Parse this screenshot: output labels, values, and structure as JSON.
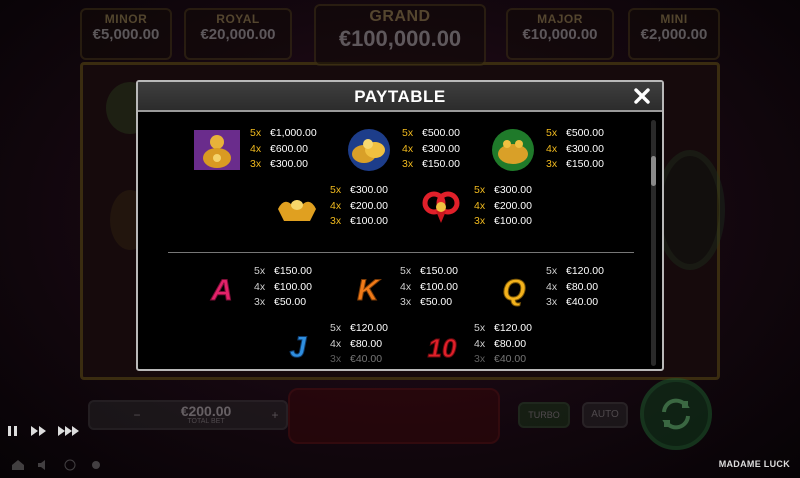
{
  "jackpots": {
    "minor": {
      "name": "MINOR",
      "value": "€5,000.00"
    },
    "royal": {
      "name": "ROYAL",
      "value": "€20,000.00"
    },
    "grand": {
      "name": "GRAND",
      "value": "€100,000.00"
    },
    "major": {
      "name": "MAJOR",
      "value": "€10,000.00"
    },
    "mini": {
      "name": "MINI",
      "value": "€2,000.00"
    }
  },
  "paytable": {
    "title": "PAYTABLE",
    "high_symbols": [
      {
        "icon": "buddha-purple-icon",
        "pays": [
          [
            "5x",
            "€1,000.00"
          ],
          [
            "4x",
            "€600.00"
          ],
          [
            "3x",
            "€300.00"
          ]
        ]
      },
      {
        "icon": "gold-coins-blue-icon",
        "pays": [
          [
            "5x",
            "€500.00"
          ],
          [
            "4x",
            "€300.00"
          ],
          [
            "3x",
            "€150.00"
          ]
        ]
      },
      {
        "icon": "money-toad-green-icon",
        "pays": [
          [
            "5x",
            "€500.00"
          ],
          [
            "4x",
            "€300.00"
          ],
          [
            "3x",
            "€150.00"
          ]
        ]
      },
      {
        "icon": "gold-ingot-icon",
        "pays": [
          [
            "5x",
            "€300.00"
          ],
          [
            "4x",
            "€200.00"
          ],
          [
            "3x",
            "€100.00"
          ]
        ]
      },
      {
        "icon": "red-knot-icon",
        "pays": [
          [
            "5x",
            "€300.00"
          ],
          [
            "4x",
            "€200.00"
          ],
          [
            "3x",
            "€100.00"
          ]
        ]
      }
    ],
    "low_symbols": [
      {
        "icon": "letter-a-icon",
        "glyph": "A",
        "color": "#e4226a",
        "pays": [
          [
            "5x",
            "€150.00"
          ],
          [
            "4x",
            "€100.00"
          ],
          [
            "3x",
            "€50.00"
          ]
        ]
      },
      {
        "icon": "letter-k-icon",
        "glyph": "K",
        "color": "#f07a18",
        "pays": [
          [
            "5x",
            "€150.00"
          ],
          [
            "4x",
            "€100.00"
          ],
          [
            "3x",
            "€50.00"
          ]
        ]
      },
      {
        "icon": "letter-q-icon",
        "glyph": "Q",
        "color": "#f3b21c",
        "pays": [
          [
            "5x",
            "€120.00"
          ],
          [
            "4x",
            "€80.00"
          ],
          [
            "3x",
            "€40.00"
          ]
        ]
      },
      {
        "icon": "letter-j-icon",
        "glyph": "J",
        "color": "#2f8fe0",
        "pays": [
          [
            "5x",
            "€120.00"
          ],
          [
            "4x",
            "€80.00"
          ],
          [
            "3x",
            "€40.00"
          ]
        ]
      },
      {
        "icon": "number-10-icon",
        "glyph": "10",
        "color": "#e0202a",
        "pays": [
          [
            "5x",
            "€120.00"
          ],
          [
            "4x",
            "€80.00"
          ],
          [
            "3x",
            "€40.00"
          ]
        ]
      }
    ]
  },
  "bet": {
    "value": "€200.00",
    "label": "TOTAL BET"
  },
  "buttons": {
    "turbo": "TURBO",
    "auto": "AUTO"
  },
  "brand": "MADAME LUCK"
}
